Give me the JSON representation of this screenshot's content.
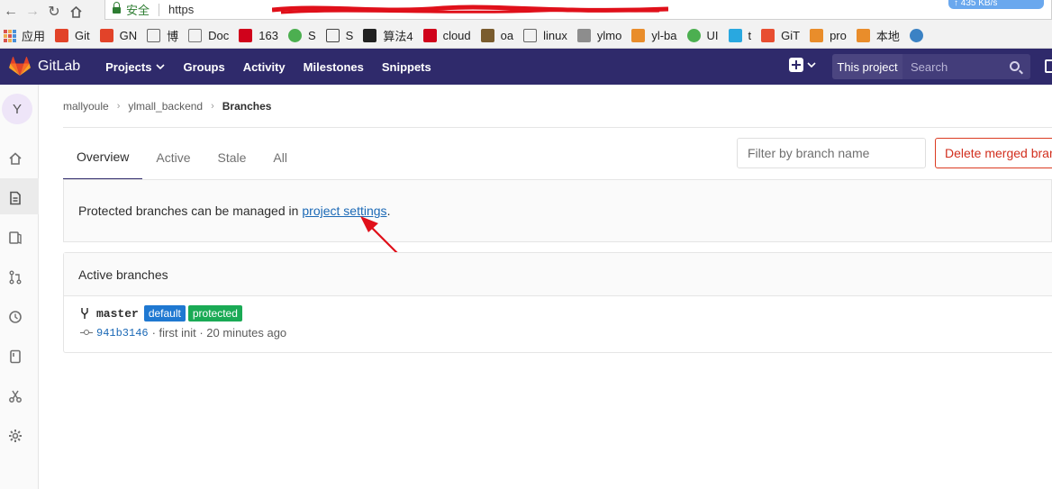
{
  "browser": {
    "security_label": "安全",
    "url_prefix": "https",
    "speed": "↑ 435 KB/s",
    "bookmarks": [
      {
        "label": "应用",
        "icon": "apps-grid-icon",
        "color": "#d9534f"
      },
      {
        "label": "Git",
        "icon": "gitlab-icon",
        "color": "#e24329"
      },
      {
        "label": "GN",
        "icon": "gitlab-icon",
        "color": "#e24329"
      },
      {
        "label": "博",
        "icon": "lambda-icon",
        "color": "#666666"
      },
      {
        "label": "Doc",
        "icon": "document-icon",
        "color": "#777777"
      },
      {
        "label": "163",
        "icon": "163-icon",
        "color": "#d0021b"
      },
      {
        "label": "S",
        "icon": "circle-icon",
        "color": "#4caf50"
      },
      {
        "label": "S",
        "icon": "network-icon",
        "color": "#444444"
      },
      {
        "label": "算法4",
        "icon": "crest-icon",
        "color": "#222222"
      },
      {
        "label": "cloud",
        "icon": "c-icon",
        "color": "#d0021b"
      },
      {
        "label": "oa",
        "icon": "f-icon",
        "color": "#7a5c2e"
      },
      {
        "label": "linux",
        "icon": "lambda-icon",
        "color": "#666666"
      },
      {
        "label": "ylmo",
        "icon": "app-icon",
        "color": "#8d8d8d"
      },
      {
        "label": "yl-ba",
        "icon": "jenkins-icon",
        "color": "#e98d2b"
      },
      {
        "label": "UI",
        "icon": "circle-icon",
        "color": "#4caf50"
      },
      {
        "label": "t",
        "icon": "diamond-icon",
        "color": "#29a8e0"
      },
      {
        "label": "GiT",
        "icon": "git-icon",
        "color": "#e84e31"
      },
      {
        "label": "pro",
        "icon": "jenkins-icon",
        "color": "#e98d2b"
      },
      {
        "label": "本地",
        "icon": "jenkins-icon",
        "color": "#e98d2b"
      },
      {
        "label": "",
        "icon": "globe-icon",
        "color": "#3b82c4"
      }
    ]
  },
  "header": {
    "brand": "GitLab",
    "nav": [
      "Projects",
      "Groups",
      "Activity",
      "Milestones",
      "Snippets"
    ],
    "scope": "This project",
    "search_placeholder": "Search"
  },
  "sidebar": {
    "avatar_letter": "Y",
    "icons": [
      "home-icon",
      "project-file-icon",
      "issues-icon",
      "merge-request-icon",
      "ci-cd-icon",
      "wiki-icon",
      "snippets-scissors-icon",
      "settings-gear-icon"
    ]
  },
  "breadcrumb": [
    "mallyoule",
    "ylmall_backend",
    "Branches"
  ],
  "tabs": [
    "Overview",
    "Active",
    "Stale",
    "All"
  ],
  "filter_placeholder": "Filter by branch name",
  "delete_button": "Delete merged branches",
  "notice": {
    "text": "Protected branches can be managed in",
    "link": "project settings",
    "suffix": "."
  },
  "panel": {
    "title": "Active branches",
    "branches": [
      {
        "name": "master",
        "badges": [
          "default",
          "protected"
        ],
        "sha": "941b3146",
        "meta": "· first init · 20 minutes ago"
      }
    ]
  },
  "colors": {
    "header_bg": "#2f2a6b",
    "link": "#1b69b6",
    "danger": "#db3b21",
    "badge_default": "#1f78d1",
    "badge_protected": "#1aaa55",
    "annotation_arrow": "#e0101a"
  }
}
